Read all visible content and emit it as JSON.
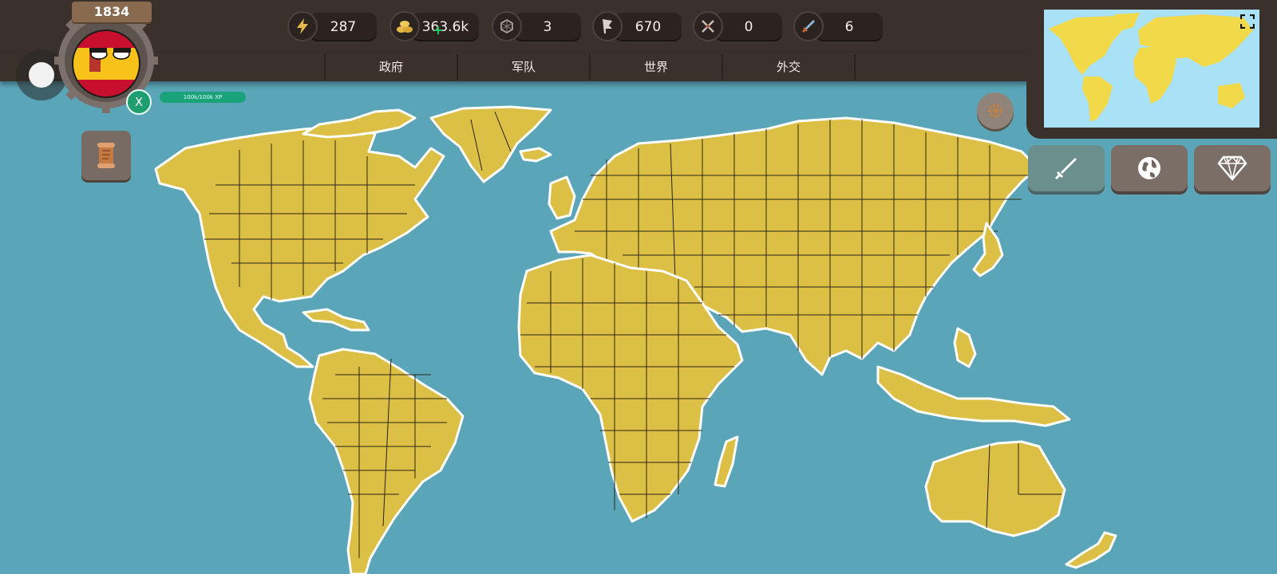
{
  "player": {
    "year": "1834",
    "xp_text": "100k/100k XP",
    "x_button_label": "X",
    "country_flag": "spain-flag-icon"
  },
  "resources": [
    {
      "icon": "lightning-icon",
      "value": "287"
    },
    {
      "icon": "gold-coins-icon",
      "value": "363.6k"
    },
    {
      "icon": "population-icon",
      "value": "3"
    },
    {
      "icon": "flag-icon",
      "value": "670"
    },
    {
      "icon": "crossed-swords-icon",
      "value": "0"
    },
    {
      "icon": "sword-icon",
      "value": "6"
    }
  ],
  "tabs": [
    "政府",
    "军队",
    "世界",
    "外交"
  ],
  "colors": {
    "ocean": "#5aa6b8",
    "land": "#dcbf45",
    "panel": "#3a302c",
    "minimap_ocean": "#a9e2f6",
    "xp_bar": "#1aa37a"
  },
  "side_buttons": [
    "sword-icon",
    "globe-icon",
    "diamond-icon"
  ]
}
